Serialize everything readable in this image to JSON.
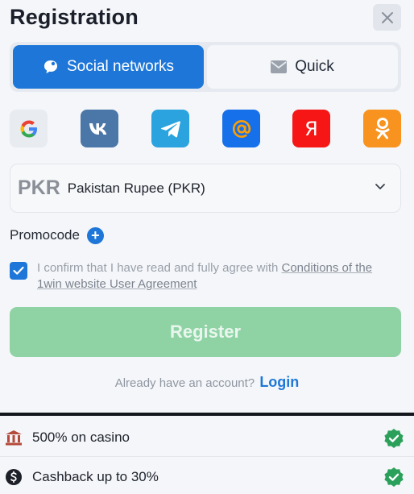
{
  "header": {
    "title": "Registration"
  },
  "tabs": [
    {
      "label": "Social networks",
      "icon": "chat-bubble-icon",
      "active": true
    },
    {
      "label": "Quick",
      "icon": "envelope-icon",
      "active": false
    }
  ],
  "socials": [
    {
      "name": "google",
      "icon": "google-icon",
      "letter": "G",
      "color": "#e8ebf0"
    },
    {
      "name": "vk",
      "icon": "vk-icon",
      "letter": "vk",
      "color": "#4a76a8"
    },
    {
      "name": "telegram",
      "icon": "telegram-icon",
      "color": "#2aa3df"
    },
    {
      "name": "mail",
      "icon": "mail-at-icon",
      "letter": "@",
      "color": "#1670ea"
    },
    {
      "name": "yandex",
      "icon": "yandex-icon",
      "letter": "Я",
      "color": "#f71616"
    },
    {
      "name": "odnoklassniki",
      "icon": "ok-icon",
      "color": "#f7931e"
    }
  ],
  "currency": {
    "code": "PKR",
    "name": "Pakistan Rupee (PKR)"
  },
  "promo": {
    "label": "Promocode",
    "add_symbol": "+"
  },
  "agreement": {
    "checked": true,
    "text": "I confirm that I have read and fully agree with ",
    "link": "Conditions of the 1win website User Agreement"
  },
  "register_label": "Register",
  "account": {
    "question": "Already have an account?",
    "login": "Login"
  },
  "bonuses": [
    {
      "icon": "casino-icon",
      "text": "500% on casino"
    },
    {
      "icon": "cashback-icon",
      "text": "Cashback up to 30%"
    }
  ],
  "colors": {
    "accent": "#1e77d8",
    "register": "#8fd3a5",
    "check_green": "#2aa05a"
  }
}
